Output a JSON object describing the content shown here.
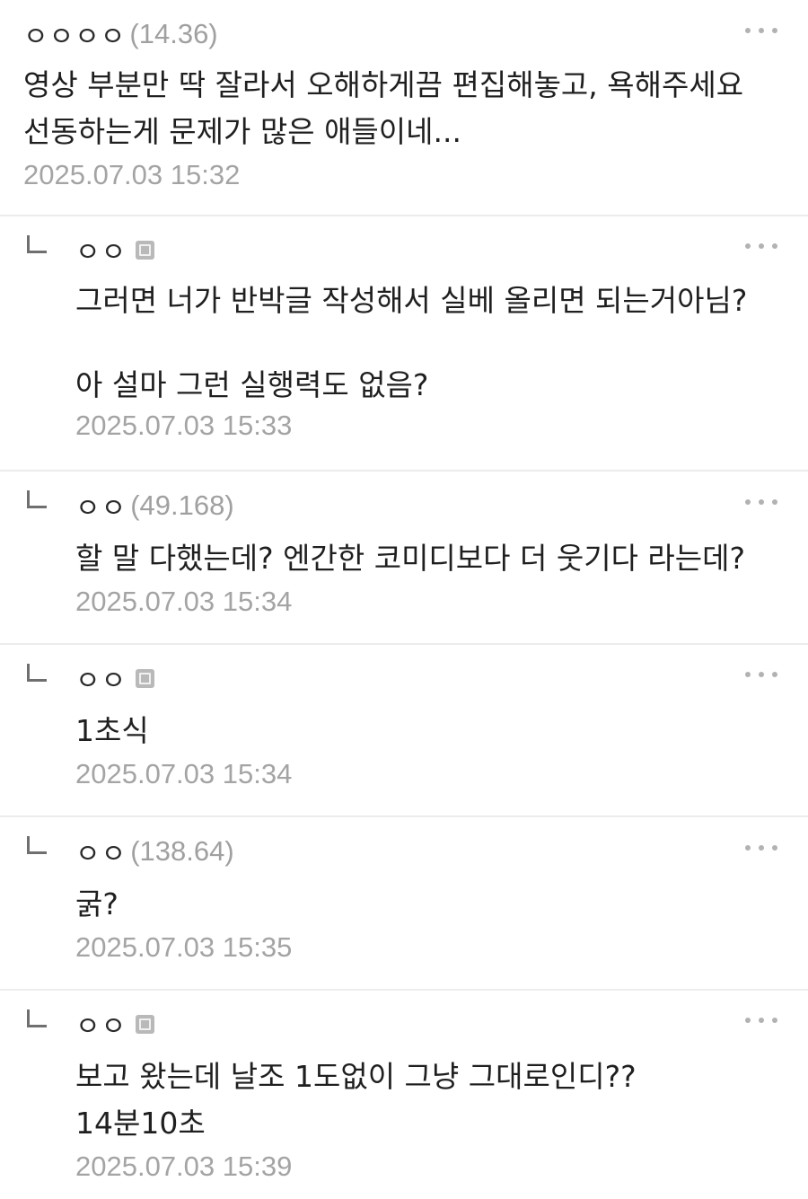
{
  "comments": [
    {
      "nick": "ㅇㅇㅇㅇ",
      "ip": "(14.36)",
      "text": "영상 부분만 딱 잘라서 오해하게끔 편집해놓고, 욕해주세요\n선동하는게 문제가 많은 애들이네...",
      "date": "2025.07.03 15:32"
    },
    {
      "nick": "ㅇㅇ",
      "ip": "",
      "text": "그러면 너가 반박글 작성해서 실베 올리면 되는거아님?\n\n아 설마 그런 실행력도 없음?",
      "date": "2025.07.03 15:33"
    },
    {
      "nick": "ㅇㅇ",
      "ip": "(49.168)",
      "text": "할 말 다했는데? 엔간한 코미디보다 더 웃기다 라는데?",
      "date": "2025.07.03 15:34"
    },
    {
      "nick": "ㅇㅇ",
      "ip": "",
      "text": "1초식",
      "date": "2025.07.03 15:34"
    },
    {
      "nick": "ㅇㅇ",
      "ip": "(138.64)",
      "text": "굵?",
      "date": "2025.07.03 15:35"
    },
    {
      "nick": "ㅇㅇ",
      "ip": "",
      "text": "보고 왔는데 날조 1도없이 그냥 그대로인디??\n14분10초",
      "date": "2025.07.03 15:39"
    }
  ]
}
